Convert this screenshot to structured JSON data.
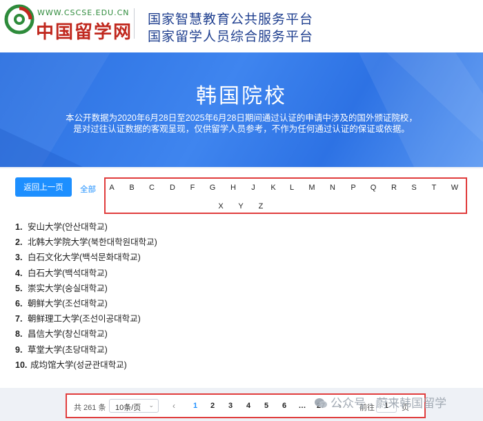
{
  "header": {
    "logo_url": "WWW.CSCSE.EDU.CN",
    "logo_text": "中国留学网",
    "platform_line1": "国家智慧教育公共服务平台",
    "platform_line2": "国家留学人员综合服务平台"
  },
  "banner": {
    "title": "韩国院校",
    "desc_line1": "本公开数据为2020年6月28日至2025年6月28日期间通过认证的申请中涉及的国外颁证院校，",
    "desc_line2": "是对过往认证数据的客观呈现，仅供留学人员参考，不作为任何通过认证的保证或依据。"
  },
  "controls": {
    "back_label": "返回上一页",
    "all_label": "全部",
    "letters": [
      "A",
      "B",
      "C",
      "D",
      "F",
      "G",
      "H",
      "J",
      "K",
      "L",
      "M",
      "N",
      "P",
      "Q",
      "R",
      "S",
      "T",
      "W",
      "X",
      "Y",
      "Z"
    ]
  },
  "universities": [
    {
      "num": "1.",
      "name": "安山大学(안산대학교)"
    },
    {
      "num": "2.",
      "name": "北韩大学院大学(북한대학원대학교)"
    },
    {
      "num": "3.",
      "name": "白石文化大学(백석문화대학교)"
    },
    {
      "num": "4.",
      "name": "白石大学(백석대학교)"
    },
    {
      "num": "5.",
      "name": "崇实大学(숭실대학교)"
    },
    {
      "num": "6.",
      "name": "朝鲜大学(조선대학교)"
    },
    {
      "num": "7.",
      "name": "朝鲜理工大学(조선이공대학교)"
    },
    {
      "num": "8.",
      "name": "昌信大学(창신대학교)"
    },
    {
      "num": "9.",
      "name": "草堂大学(초당대학교)"
    },
    {
      "num": "10.",
      "name": "成均馆大学(성균관대학교)"
    }
  ],
  "pagination": {
    "total_text": "共 261 条",
    "page_size": "10条/页",
    "pages": [
      "1",
      "2",
      "3",
      "4",
      "5",
      "6",
      "…",
      "27"
    ],
    "current_page": "1",
    "goto_label": "前往",
    "goto_value": "1",
    "goto_suffix": "页"
  },
  "watermark": {
    "text": "公众号 · 蔚来韩国留学"
  },
  "colors": {
    "accent": "#1d8fff",
    "banner": "#3f85ef",
    "highlight_border": "#e03c3c",
    "logo_red": "#c0281e",
    "logo_green": "#2e8b3b",
    "platform_text": "#1f3f8f"
  }
}
